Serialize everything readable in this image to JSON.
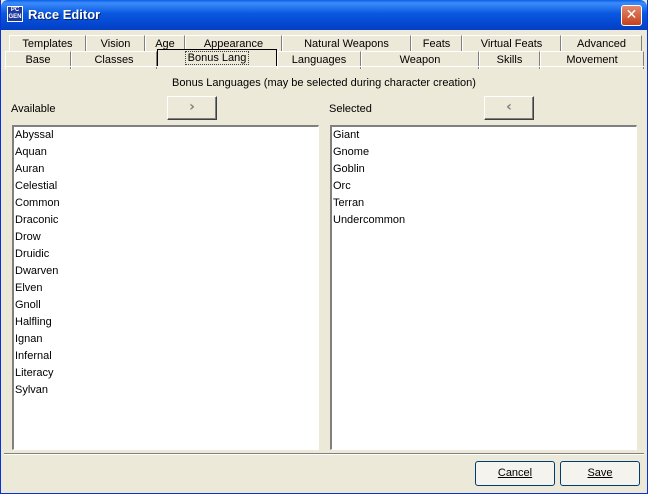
{
  "window": {
    "title": "Race Editor",
    "icon_text_top": "PC",
    "icon_text_bottom": "GEN",
    "close_glyph": "✕"
  },
  "tabs_top": [
    {
      "label": "Templates"
    },
    {
      "label": "Vision"
    },
    {
      "label": "Age"
    },
    {
      "label": "Appearance"
    },
    {
      "label": "Natural Weapons"
    },
    {
      "label": "Feats"
    },
    {
      "label": "Virtual Feats"
    },
    {
      "label": "Advanced"
    }
  ],
  "tabs_bottom": [
    {
      "label": "Base"
    },
    {
      "label": "Classes"
    },
    {
      "label": "Bonus Lang",
      "active": true
    },
    {
      "label": "Languages"
    },
    {
      "label": "Weapon"
    },
    {
      "label": "Skills"
    },
    {
      "label": "Movement"
    }
  ],
  "panel": {
    "caption": "Bonus Languages (may be selected during character creation)",
    "available_label": "Available",
    "selected_label": "Selected",
    "add_glyph": "›",
    "remove_glyph": "‹",
    "available": [
      "Abyssal",
      "Aquan",
      "Auran",
      "Celestial",
      "Common",
      "Draconic",
      "Drow",
      "Druidic",
      "Dwarven",
      "Elven",
      "Gnoll",
      "Halfling",
      "Ignan",
      "Infernal",
      "Literacy",
      "Sylvan"
    ],
    "selected": [
      "Giant",
      "Gnome",
      "Goblin",
      "Orc",
      "Terran",
      "Undercommon"
    ]
  },
  "buttons": {
    "cancel": "Cancel",
    "save": "Save"
  }
}
